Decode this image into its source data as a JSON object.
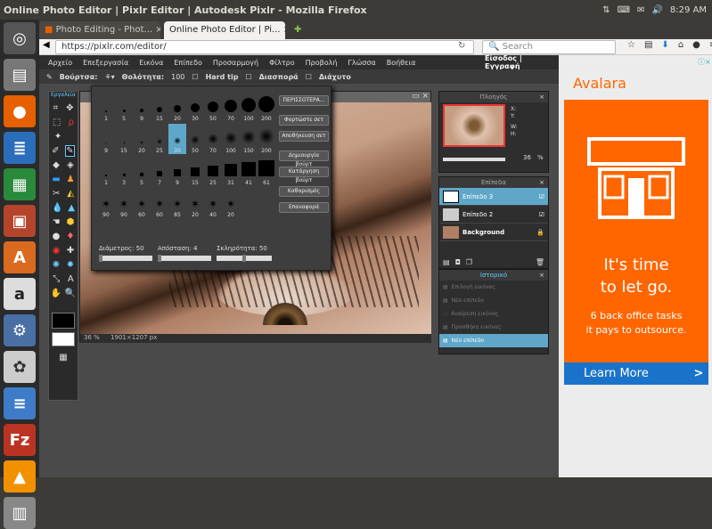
{
  "os": {
    "window_title": "Online Photo Editor | Pixlr Editor | Autodesk Pixlr - Mozilla Firefox",
    "time": "8:29 AM"
  },
  "browser": {
    "tabs": [
      {
        "label": "Photo Editing - Phot..."
      },
      {
        "label": "Online Photo Editor | Pi..."
      }
    ],
    "url": "https://pixlr.com/editor/",
    "search_placeholder": "Search"
  },
  "menu": {
    "items": [
      "Αρχείο",
      "Επεξεργασία",
      "Εικόνα",
      "Επίπεδο",
      "Προσαρμογή",
      "Φίλτρο",
      "Προβολή",
      "Γλώσσα",
      "Βοήθεια"
    ],
    "login": "Είσοδος | Εγγραφή"
  },
  "options": {
    "brush_label": "Βούρτσα:",
    "opacity_label": "Θολότητα:",
    "opacity_value": "100",
    "hardtip": "Hard tip",
    "scatter": "Διασπορά",
    "smooth": "Διάχυτο"
  },
  "tools_title": "Εργαλεία",
  "brush_popup": {
    "rows": [
      [
        "1",
        "5",
        "9",
        "15",
        "20",
        "30",
        "50",
        "70",
        "100",
        "200"
      ],
      [
        "9",
        "15",
        "20",
        "25",
        "30",
        "50",
        "70",
        "100",
        "150",
        "200"
      ],
      [
        "1",
        "3",
        "5",
        "7",
        "9",
        "15",
        "25",
        "31",
        "41",
        "61"
      ],
      [
        "90",
        "90",
        "60",
        "60",
        "85",
        "20",
        "40",
        "20"
      ]
    ],
    "buttons": [
      "ΠΕΡΙΣΣΟΤΕΡΑ...",
      "Φορτώστε σετ",
      "Αποθήκευση σετ",
      "Δημιουργία βούρτ",
      "Κατάργηση βούρτ",
      "Καθαρισμός",
      "Επαναφορά"
    ],
    "diameter_label": "Διάμετρος:",
    "diameter_value": "50",
    "spacing_label": "Απόσταση:",
    "spacing_value": "4",
    "hardness_label": "Σκληρότητα:",
    "hardness_value": "50",
    "diameter_fraction": 0.03,
    "spacing_fraction": 0.03,
    "hardness_fraction": 0.5
  },
  "canvas": {
    "zoom": "36",
    "unit": "%",
    "size": "1901×1207 px"
  },
  "navigator": {
    "title": "Πλοηγός",
    "x": "X:",
    "y": "Y:",
    "w": "W:",
    "h": "H:",
    "zoom": "36",
    "unit": "%"
  },
  "layers": {
    "title": "Επίπεδα",
    "items": [
      {
        "name": "Επίπεδο 3",
        "active": true
      },
      {
        "name": "Επίπεδο 2",
        "active": false
      },
      {
        "name": "Background",
        "active": false
      }
    ]
  },
  "history": {
    "title": "Ιστορικό",
    "items": [
      "Επιλογή εικόνας",
      "Νέο επίπεδο",
      "Αναίρεση εικόνας",
      "Προσθήκη εικόνας",
      "Νέο επίπεδο"
    ]
  },
  "ad": {
    "brand": "Avalara",
    "headline1": "It's time",
    "headline2": "to let go.",
    "sub1": "6 back office tasks",
    "sub2": "it pays to outsource.",
    "cta": "Learn More",
    "cta_arrow": ">",
    "accent": "#ff6600",
    "cta_color": "#1a73c9"
  }
}
